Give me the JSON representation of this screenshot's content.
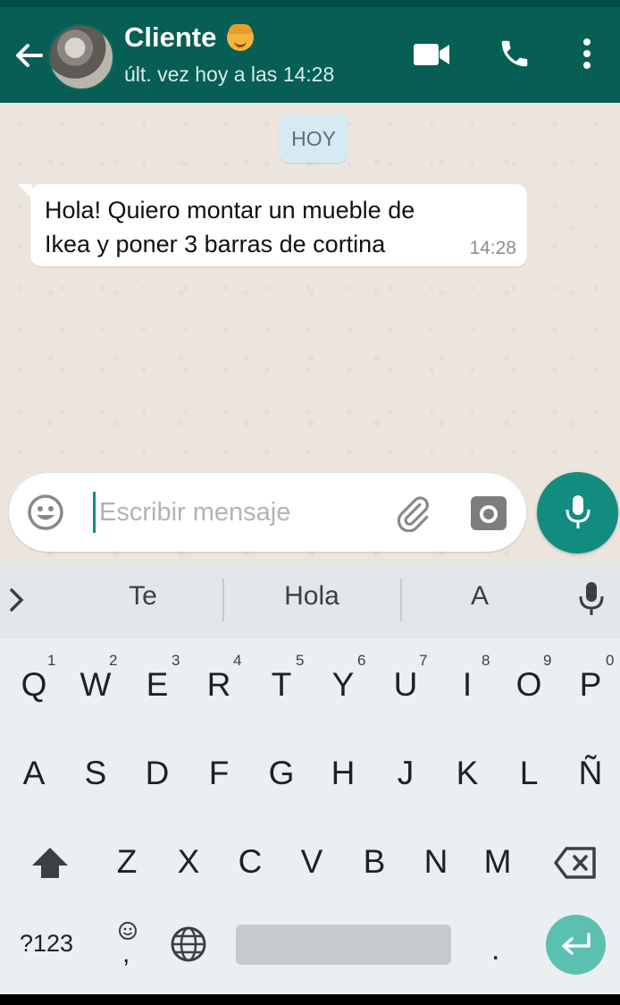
{
  "header": {
    "contact_name": "Cliente",
    "last_seen": "últ. vez hoy a las 14:28",
    "bg_color": "#075E54",
    "icons": [
      "back-arrow-icon",
      "video-call-icon",
      "phone-call-icon",
      "more-vert-icon"
    ]
  },
  "chat": {
    "day_label": "HOY",
    "messages": [
      {
        "text_line1": "Hola! Quiero montar un mueble de",
        "text_line2": "Ikea y poner 3 barras de cortina",
        "time": "14:28"
      }
    ]
  },
  "composer": {
    "placeholder": "Escribir mensaje",
    "accent": "#128C7E",
    "icons": [
      "emoji-icon",
      "attach-icon",
      "camera-icon",
      "mic-icon"
    ]
  },
  "keyboard": {
    "suggestions": [
      "Te",
      "Hola",
      "A"
    ],
    "row1": [
      "Q",
      "W",
      "E",
      "R",
      "T",
      "Y",
      "U",
      "I",
      "O",
      "P"
    ],
    "row1_nums": [
      "1",
      "2",
      "3",
      "4",
      "5",
      "6",
      "7",
      "8",
      "9",
      "0"
    ],
    "row2": [
      "A",
      "S",
      "D",
      "F",
      "G",
      "H",
      "J",
      "K",
      "L",
      "Ñ"
    ],
    "row3": [
      "Z",
      "X",
      "C",
      "V",
      "B",
      "N",
      "M"
    ],
    "symbols_label": "?123",
    "comma": ",",
    "period": ".",
    "enter_color": "#5BC0B0"
  }
}
